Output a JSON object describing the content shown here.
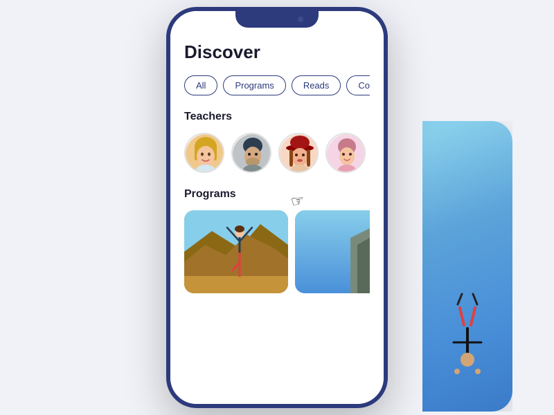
{
  "page": {
    "title": "Discover",
    "background": "#f0f2f7"
  },
  "filter_tabs": {
    "items": [
      {
        "id": "all",
        "label": "All",
        "active": true
      },
      {
        "id": "programs",
        "label": "Programs",
        "active": false
      },
      {
        "id": "reads",
        "label": "Reads",
        "active": false
      },
      {
        "id": "connections",
        "label": "Connections",
        "active": false
      }
    ]
  },
  "teachers_section": {
    "title": "Teachers",
    "avatars": [
      {
        "id": 1,
        "color_class": "avatar-1"
      },
      {
        "id": 2,
        "color_class": "avatar-2"
      },
      {
        "id": 3,
        "color_class": "avatar-3"
      },
      {
        "id": 4,
        "color_class": "avatar-4"
      },
      {
        "id": 5,
        "color_class": "avatar-5"
      }
    ]
  },
  "programs_section": {
    "title": "Programs",
    "cards": [
      {
        "id": 1,
        "theme": "desert-yoga"
      },
      {
        "id": 2,
        "theme": "ocean-acrobatics"
      }
    ]
  }
}
